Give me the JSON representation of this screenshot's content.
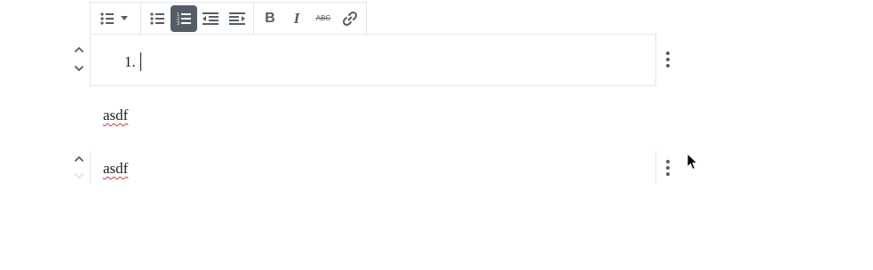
{
  "toolbar": {
    "block_switcher_icon": "list-icon",
    "block_switcher_chevron": "caret-down-icon",
    "buttons": [
      {
        "name": "unordered-list-button",
        "icon": "bullet-list-icon",
        "active": false
      },
      {
        "name": "ordered-list-button",
        "icon": "numbered-list-icon",
        "active": true
      },
      {
        "name": "outdent-button",
        "icon": "outdent-icon",
        "active": false
      },
      {
        "name": "indent-button",
        "icon": "indent-icon",
        "active": false
      },
      {
        "name": "bold-button",
        "icon": "bold-icon",
        "active": false
      },
      {
        "name": "italic-button",
        "icon": "italic-icon",
        "active": false
      },
      {
        "name": "strikethrough-button",
        "icon": "strikethrough-icon",
        "active": false
      },
      {
        "name": "link-button",
        "icon": "link-icon",
        "active": false
      }
    ],
    "bold_glyph": "B",
    "italic_glyph": "I",
    "strike_glyph": "ABC"
  },
  "list_block": {
    "item_marker": "1.",
    "item_text": ""
  },
  "paragraphs": [
    {
      "text": "asdf"
    },
    {
      "text": "asdf"
    }
  ],
  "colors": {
    "active_button_bg": "#555d66",
    "border": "#e2e4e7",
    "icon": "#555d66",
    "spellcheck": "#d63638"
  }
}
